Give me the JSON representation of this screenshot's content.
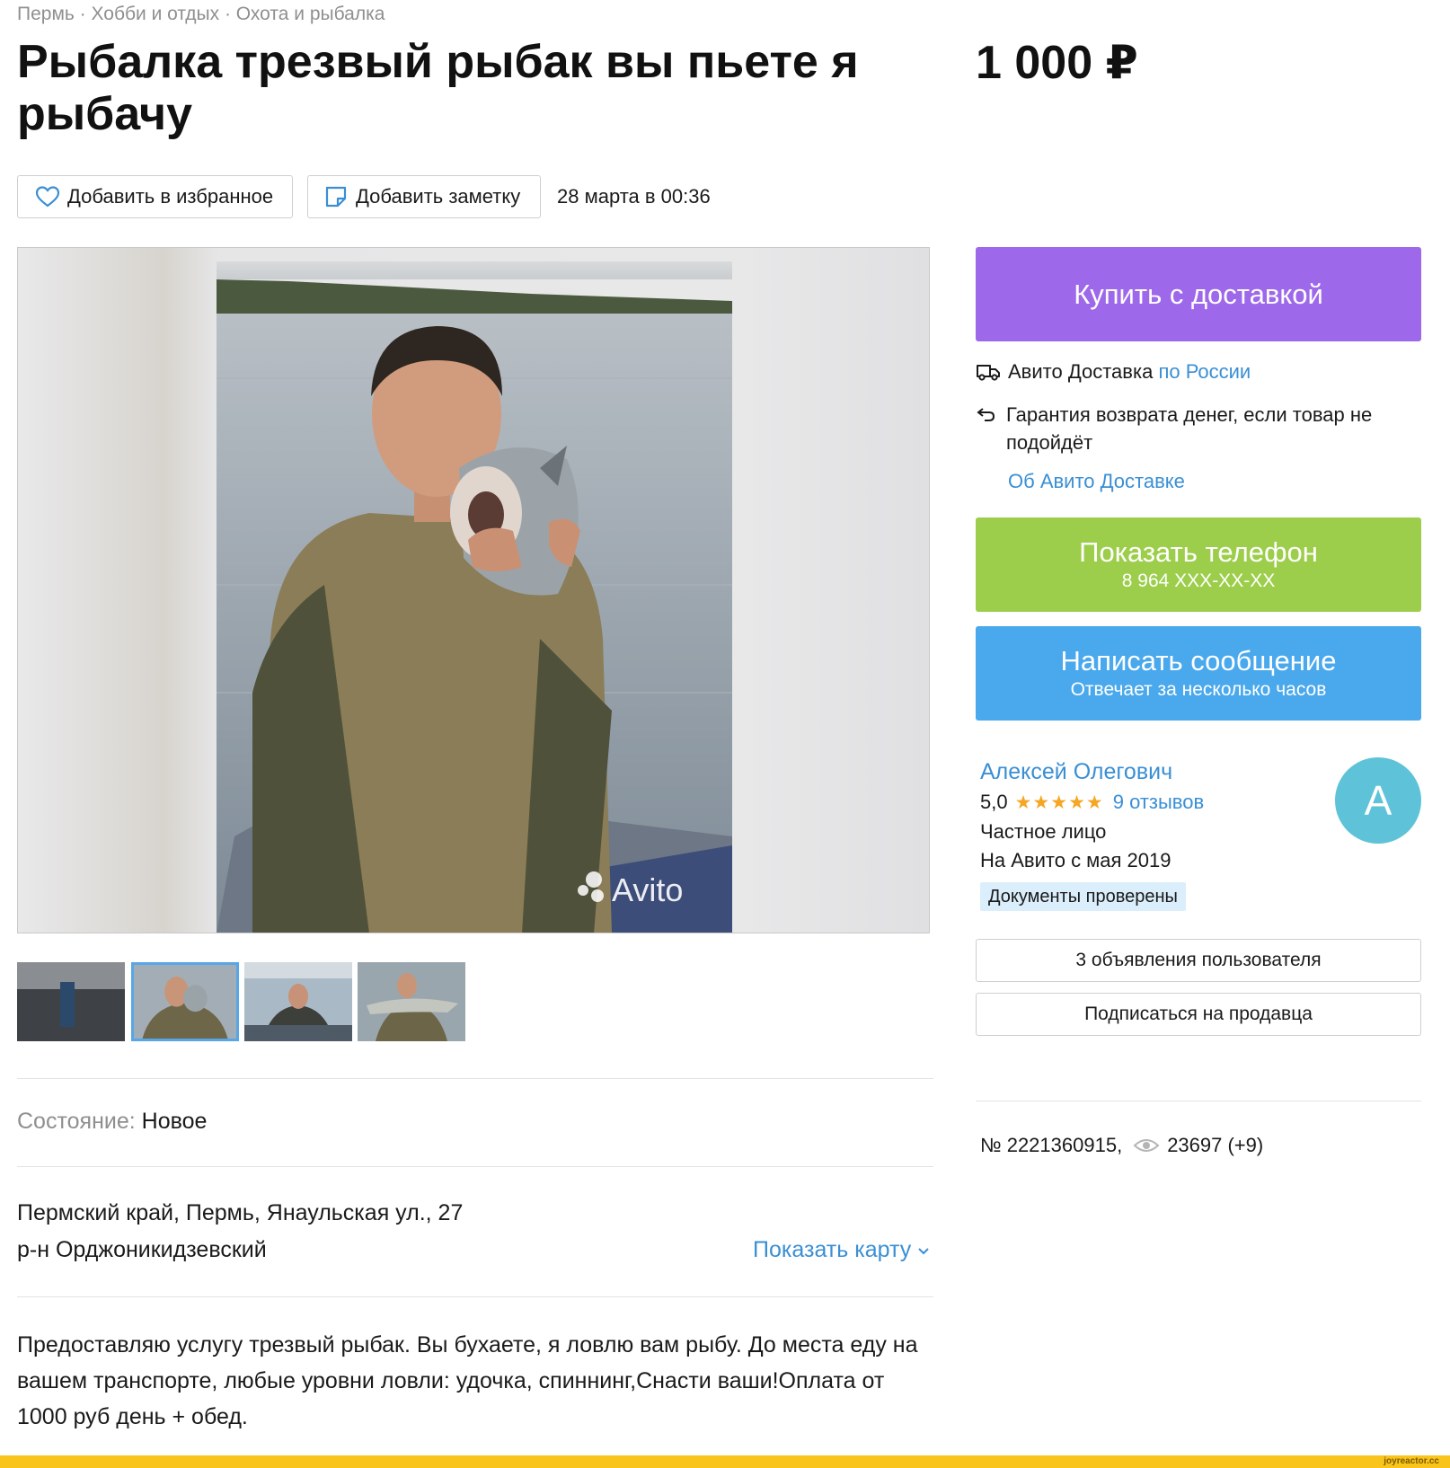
{
  "breadcrumb": "Пермь · Хобби и отдых · Охота и рыбалка",
  "title": "Рыбалка трезвый рыбак вы пьете я рыбачу",
  "price": "1 000 ₽",
  "actions": {
    "favorite_label": "Добавить в избранное",
    "note_label": "Добавить заметку",
    "date": "28 марта в 00:36"
  },
  "gallery": {
    "watermark": "Avito",
    "thumbnail_count": 4,
    "active_thumbnail": 2
  },
  "details": {
    "condition_label": "Состояние:",
    "condition_value": "Новое",
    "address_line1": "Пермский край, Пермь, Янаульская ул., 27",
    "address_line2": "р-н Орджоникидзевский",
    "show_map": "Показать карту",
    "description": "Предоставляю услугу трезвый рыбак. Вы бухаете, я ловлю вам рыбу. До места еду на вашем транспорте, любые уровни ловли: удочка, спиннинг,Снасти ваши!Оплата от 1000 руб день + обед."
  },
  "sidebar": {
    "buy_button": "Купить с доставкой",
    "delivery_text": "Авито Доставка",
    "delivery_link": "по России",
    "guarantee": "Гарантия возврата денег, если товар не подойдёт",
    "about_delivery": "Об Авито Доставке",
    "phone_button": "Показать телефон",
    "phone_number": "8 964 XXX-XX-XX",
    "message_button": "Написать сообщение",
    "message_sub": "Отвечает за несколько часов",
    "seller": {
      "name": "Алексей Олегович",
      "rating": "5,0",
      "stars": "★★★★★",
      "reviews": "9 отзывов",
      "type": "Частное лицо",
      "since": "На Авито с мая 2019",
      "verified": "Документы проверены",
      "avatar_letter": "А"
    },
    "ads_button": "3 объявления пользователя",
    "subscribe_button": "Подписаться на продавца",
    "ad_number": "№ 2221360915,",
    "views": "23697 (+9)"
  },
  "footer": {
    "watermark": "joyreactor.cc"
  },
  "colors": {
    "buy": "#9d68ea",
    "phone": "#9cce4b",
    "message": "#4aa8ec",
    "link": "#3a8fd4",
    "avatar": "#5ec3d8",
    "stars": "#f5a623",
    "bottom_bar": "#f9c41b"
  }
}
